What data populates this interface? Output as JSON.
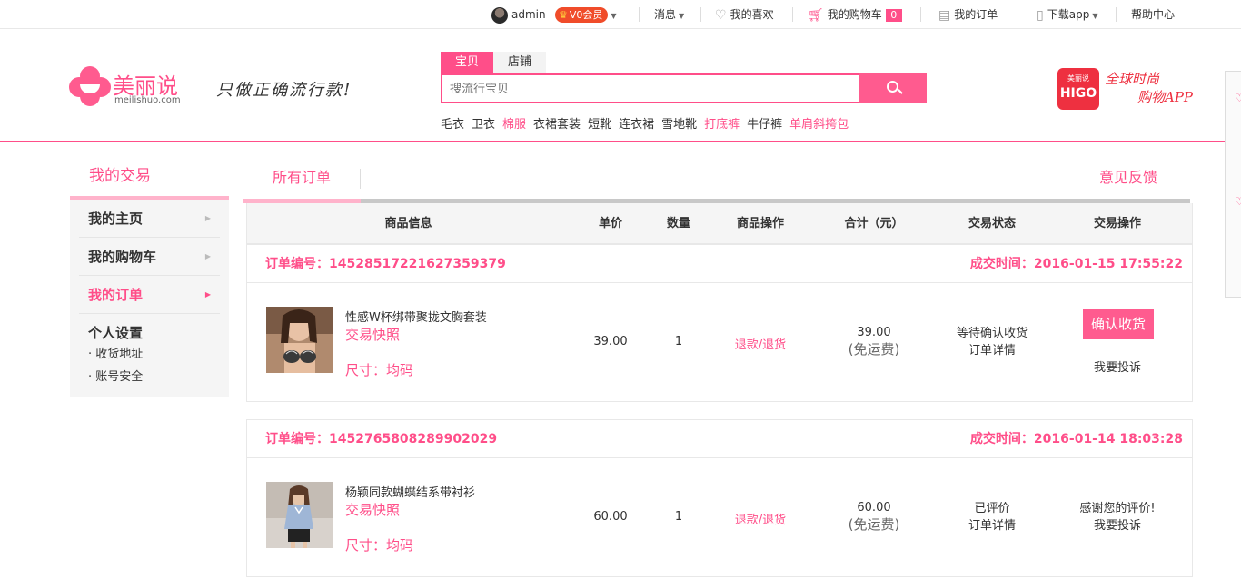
{
  "topbar": {
    "username": "admin",
    "vip": "V0会员",
    "messages": "消息",
    "favorites": "我的喜欢",
    "cart": "我的购物车",
    "cart_count": "0",
    "orders": "我的订单",
    "download": "下载app",
    "help": "帮助中心"
  },
  "header": {
    "logo_cn": "美丽说",
    "logo_en": "meilishuo.com",
    "slogan": "只做正确流行款!",
    "search_tabs": [
      "宝贝",
      "店铺"
    ],
    "search_placeholder": "搜流行宝贝",
    "hotwords": [
      {
        "text": "毛衣",
        "highlight": false
      },
      {
        "text": "卫衣",
        "highlight": false
      },
      {
        "text": "棉服",
        "highlight": true
      },
      {
        "text": "衣裙套装",
        "highlight": false
      },
      {
        "text": "短靴",
        "highlight": false
      },
      {
        "text": "连衣裙",
        "highlight": false
      },
      {
        "text": "雪地靴",
        "highlight": false
      },
      {
        "text": "打底裤",
        "highlight": true
      },
      {
        "text": "牛仔裤",
        "highlight": false
      },
      {
        "text": "单肩斜挎包",
        "highlight": true
      }
    ],
    "higo_small": "美丽说",
    "higo_big": "HIGO",
    "higo_line1": "全球时尚",
    "higo_line2": "购物APP"
  },
  "leftnav": {
    "title": "我的交易",
    "items": [
      "我的主页",
      "我的购物车",
      "我的订单"
    ],
    "active": "我的订单",
    "settings_title": "个人设置",
    "settings_items": [
      "· 收货地址",
      "· 账号安全"
    ]
  },
  "main": {
    "tab_all": "所有订单",
    "feedback": "意见反馈",
    "columns": [
      "商品信息",
      "单价",
      "数量",
      "商品操作",
      "合计（元）",
      "交易状态",
      "交易操作"
    ]
  },
  "orders": [
    {
      "no_label": "订单编号：",
      "no": "14528517221627359379",
      "time_label": "成交时间：",
      "time": "2016-01-15 17:55:22",
      "product": "性感W杯绑带聚拢文胸套装",
      "snapshot": "交易快照",
      "size": "尺寸：均码",
      "price": "39.00",
      "qty": "1",
      "action": "退款/退货",
      "total": "39.00",
      "shipping": "(免运费)",
      "status": "等待确认收货",
      "detail": "订单详情",
      "button": "确认收货",
      "complain": "我要投诉"
    },
    {
      "no_label": "订单编号：",
      "no": "1452765808289902029",
      "time_label": "成交时间：",
      "time": "2016-01-14 18:03:28",
      "product": "杨颖同款蝴蝶结系带衬衫",
      "snapshot": "交易快照",
      "size": "尺寸：均码",
      "price": "60.00",
      "qty": "1",
      "action": "退款/退货",
      "total": "60.00",
      "shipping": "(免运费)",
      "status": "已评价",
      "detail": "订单详情",
      "thanks": "感谢您的评价!",
      "complain": "我要投诉"
    }
  ],
  "colors": {
    "accent": "#ff4e89",
    "button": "#ff5b8f",
    "higo": "#ee3040"
  }
}
